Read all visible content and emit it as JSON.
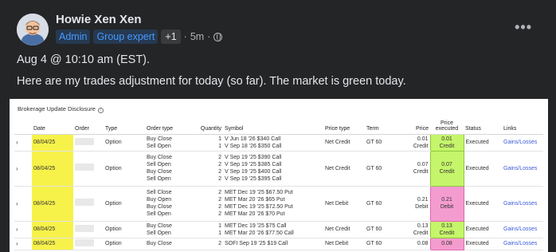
{
  "post": {
    "author": "Howie Xen Xen",
    "badges": [
      "Admin",
      "Group expert",
      "+1"
    ],
    "time": "5m",
    "line1": "Aug 4 @ 10:10 am (EST).",
    "line2": "Here are my trades adjustment for today (so far). The market is green today."
  },
  "statement": {
    "title": "Brokerage Update Disclosure",
    "headers": [
      "Date",
      "Order",
      "Type",
      "Order type",
      "Quantity",
      "Symbol",
      "Price type",
      "Term",
      "Price",
      "Price executed",
      "Status",
      "Links"
    ],
    "rows": [
      {
        "date": "08/04/25",
        "type": "Option",
        "order_types": [
          "Buy Close",
          "Sell Open"
        ],
        "quantities": [
          "1",
          "1"
        ],
        "symbols": [
          "V Jun 18 '26 $340 Call",
          "V Sep 18 '26 $350 Call"
        ],
        "price_type": "Net Credit",
        "term": "GT 60",
        "price": "0.01",
        "price_side": "Credit",
        "executed": "0.01",
        "executed_side": "Credit",
        "exec_color": "#c5f56a",
        "status": "Executed",
        "link": "Gains/Losses"
      },
      {
        "date": "08/04/25",
        "type": "Option",
        "order_types": [
          "Buy Close",
          "Sell Open",
          "Buy Close",
          "Sell Open"
        ],
        "quantities": [
          "2",
          "2",
          "2",
          "2"
        ],
        "symbols": [
          "V Sep 19 '25 $390 Call",
          "V Sep 19 '25 $385 Call",
          "V Sep 19 '25 $400 Call",
          "V Sep 19 '25 $395 Call"
        ],
        "price_type": "Net Credit",
        "term": "GT 60",
        "price": "0.07",
        "price_side": "Credit",
        "executed": "0.07",
        "executed_side": "Credit",
        "exec_color": "#c5f56a",
        "status": "Executed",
        "link": "Gains/Losses"
      },
      {
        "date": "08/04/25",
        "type": "Option",
        "order_types": [
          "Sell Close",
          "Buy Open",
          "Buy Close",
          "Sell Open"
        ],
        "quantities": [
          "2",
          "2",
          "2",
          "2"
        ],
        "symbols": [
          "MET Dec 19 '25 $67.50 Put",
          "MET Mar 20 '26 $65 Put",
          "MET Dec 19 '25 $72.50 Put",
          "MET Mar 20 '26 $70 Put"
        ],
        "price_type": "Net Debit",
        "term": "GT 60",
        "price": "0.21",
        "price_side": "Debit",
        "executed": "0.21",
        "executed_side": "Debit",
        "exec_color": "#f49ccf",
        "status": "Executed",
        "link": "Gains/Losses"
      },
      {
        "date": "08/04/25",
        "type": "Option",
        "order_types": [
          "Buy Close",
          "Sell Open"
        ],
        "quantities": [
          "1",
          "1"
        ],
        "symbols": [
          "MET Dec 19 '25 $75 Call",
          "MET Mar 20 '26 $77.50 Call"
        ],
        "price_type": "Net Credit",
        "term": "GT 60",
        "price": "0.13",
        "price_side": "Credit",
        "executed": "0.13",
        "executed_side": "Credit",
        "exec_color": "#c5f56a",
        "status": "Executed",
        "link": "Gains/Losses"
      },
      {
        "date": "08/04/25",
        "type": "Option",
        "order_types": [
          "Buy Close"
        ],
        "quantities": [
          "2"
        ],
        "symbols": [
          "SOFI Sep 19 '25 $19 Call"
        ],
        "price_type": "Net Debit",
        "term": "GT 60",
        "price": "0.08",
        "price_side": "",
        "executed": "0.08",
        "executed_side": "",
        "exec_color": "#f49ccf",
        "status": "Executed",
        "link": "Gains/Losses"
      }
    ]
  }
}
